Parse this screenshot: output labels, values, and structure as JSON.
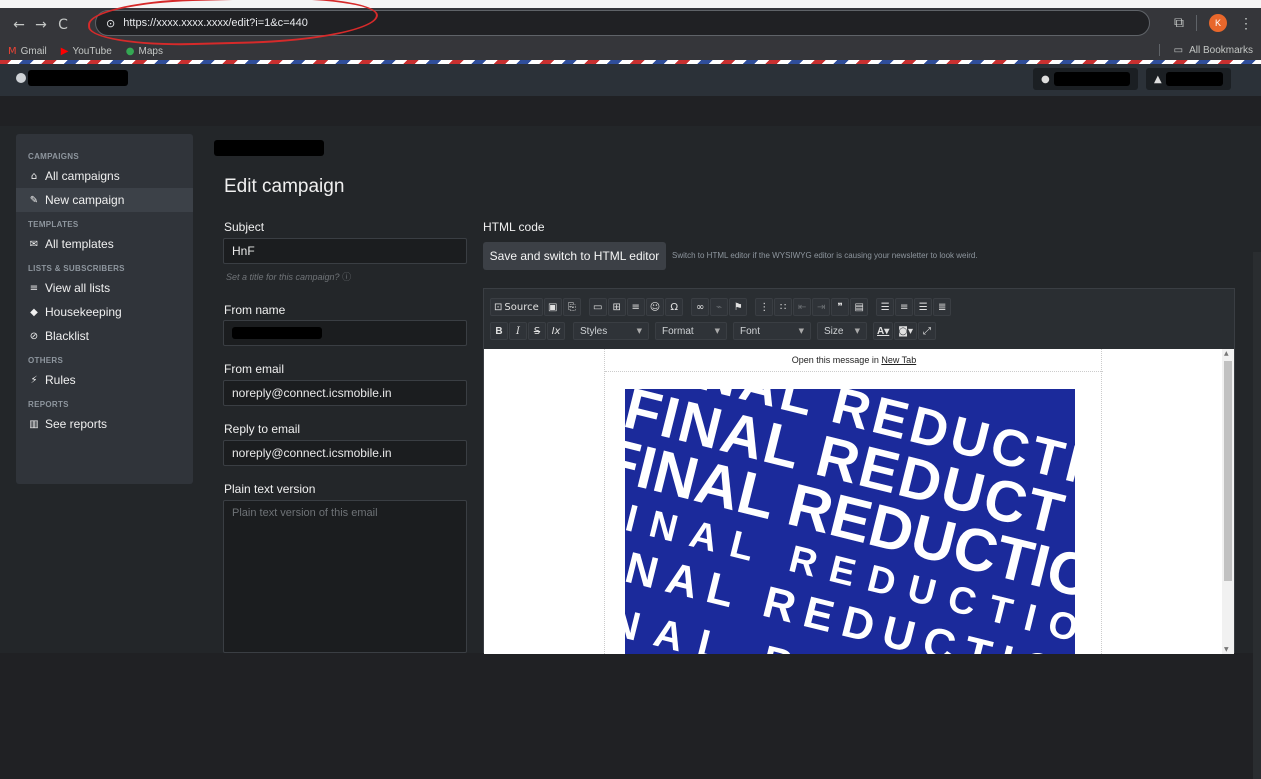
{
  "browser": {
    "url": "https://xxxx.xxxx.xxxx/edit?i=1&c=440",
    "profile_initial": "K",
    "bookmarks": [
      {
        "label": "Gmail",
        "icon": "gmail-icon"
      },
      {
        "label": "YouTube",
        "icon": "youtube-icon"
      },
      {
        "label": "Maps",
        "icon": "maps-icon"
      }
    ],
    "all_bookmarks": "All Bookmarks"
  },
  "header": {
    "user_initial": "A."
  },
  "sidebar": {
    "sections": [
      {
        "title": "CAMPAIGNS",
        "items": [
          {
            "label": "All campaigns",
            "icon": "home-icon"
          },
          {
            "label": "New campaign",
            "icon": "edit-icon",
            "active": true
          }
        ]
      },
      {
        "title": "TEMPLATES",
        "items": [
          {
            "label": "All templates",
            "icon": "envelope-icon"
          }
        ]
      },
      {
        "title": "LISTS & SUBSCRIBERS",
        "items": [
          {
            "label": "View all lists",
            "icon": "list-icon"
          },
          {
            "label": "Housekeeping",
            "icon": "leaf-icon"
          },
          {
            "label": "Blacklist",
            "icon": "ban-icon"
          }
        ]
      },
      {
        "title": "OTHERS",
        "items": [
          {
            "label": "Rules",
            "icon": "wand-icon"
          }
        ]
      },
      {
        "title": "REPORTS",
        "items": [
          {
            "label": "See reports",
            "icon": "chart-icon"
          }
        ]
      }
    ]
  },
  "form": {
    "page_title": "Edit campaign",
    "subject_label": "Subject",
    "subject_value": "HnF",
    "subject_hint": "Set a title for this campaign?",
    "from_name_label": "From name",
    "from_email_label": "From email",
    "from_email_value": "noreply@connect.icsmobile.in",
    "reply_to_label": "Reply to email",
    "reply_to_value": "noreply@connect.icsmobile.in",
    "plain_text_label": "Plain text version",
    "plain_text_placeholder": "Plain text version of this email"
  },
  "editor": {
    "html_code_label": "HTML code",
    "save_button": "Save and switch to HTML editor",
    "save_hint": "Switch to HTML editor if the WYSIWYG editor is causing your newsletter to look weird.",
    "source_label": "Source",
    "styles_label": "Styles",
    "format_label": "Format",
    "font_label": "Font",
    "size_label": "Size",
    "bold": "B",
    "italic": "I",
    "strike": "S",
    "clear": "Ix",
    "open_msg_prefix": "Open this message in",
    "open_msg_link": "New Tab",
    "banner_lines": [
      "FINAL REDUCTI",
      "FINAL REDUCT",
      "FINAL REDUCTION",
      "FINAL REDUCTION",
      "FINAL REDUCTION",
      "FINAL REDUCTION"
    ]
  },
  "colors": {
    "banner_blue": "#1b2a9b",
    "accent_red": "#d62a2a"
  }
}
